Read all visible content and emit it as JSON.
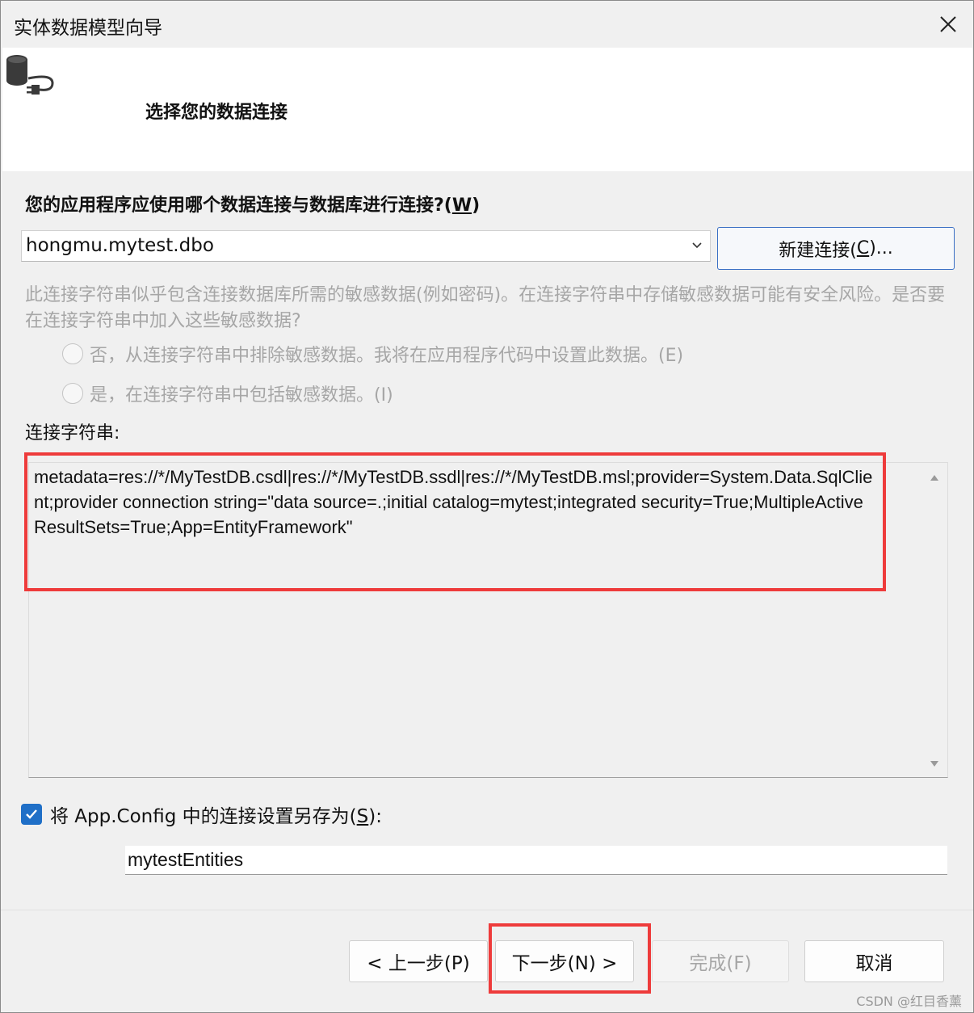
{
  "window": {
    "title": "实体数据模型向导",
    "close_glyph": "✕"
  },
  "header": {
    "icon": "database-plug-icon",
    "title": "选择您的数据连接"
  },
  "question": {
    "text": "您的应用程序应使用哪个数据连接与数据库进行连接?(",
    "hotkey": "W",
    "suffix": ")"
  },
  "connection_select": {
    "value": "hongmu.mytest.dbo"
  },
  "new_connection_button": {
    "label_prefix": "新建连接(",
    "hotkey": "C",
    "label_suffix": ")..."
  },
  "sensitive": {
    "text": "此连接字符串似乎包含连接数据库所需的敏感数据(例如密码)。在连接字符串中存储敏感数据可能有安全风险。是否要在连接字符串中加入这些敏感数据?",
    "option_exclude": "否，从连接字符串中排除敏感数据。我将在应用程序代码中设置此数据。(E)",
    "option_include": "是，在连接字符串中包括敏感数据。(I)"
  },
  "connection_string": {
    "label": "连接字符串:",
    "value": "metadata=res://*/MyTestDB.csdl|res://*/MyTestDB.ssdl|res://*/MyTestDB.msl;provider=System.Data.SqlClient;provider connection string=\"data source=.;initial catalog=mytest;integrated security=True;MultipleActiveResultSets=True;App=EntityFramework\""
  },
  "save_config": {
    "checked": true,
    "label_prefix": "将 App.Config 中的连接设置另存为(",
    "hotkey": "S",
    "label_suffix": "):",
    "name_value": "mytestEntities"
  },
  "buttons": {
    "back": "< 上一步(P)",
    "next": "下一步(N) >",
    "finish": "完成(F)",
    "cancel": "取消"
  },
  "watermark": "CSDN @红目香薰",
  "colors": {
    "highlight": "#ee3b3b",
    "accent": "#1f6fc7",
    "disabled_text": "#a6a6a6"
  }
}
